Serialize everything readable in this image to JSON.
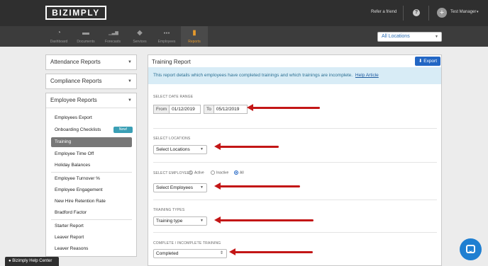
{
  "colors": {
    "topbar": "#2f2f2f",
    "nav": "#3c3c3c",
    "accent": "#e69a2c",
    "primary": "#2266c4",
    "arrow": "#c31616",
    "info_bg": "#d8ecf6",
    "badge": "#3a9fb5"
  },
  "header": {
    "logo": "BIZIMPLY",
    "refer_label": "Refer a friend",
    "help_icon": "question-circle-icon",
    "help_glyph": "?",
    "user_name": "Test Manager",
    "user_caret": "▾",
    "avatar_glyph": "+"
  },
  "nav": {
    "items": [
      {
        "label": "Dashboard",
        "icon": "dashboard-icon",
        "glyph": "◔"
      },
      {
        "label": "Documents",
        "icon": "folder-icon",
        "glyph": "▬"
      },
      {
        "label": "Forecasts",
        "icon": "bar-chart-icon",
        "glyph": "▁▃▆"
      },
      {
        "label": "Services",
        "icon": "tag-icon",
        "glyph": "◆"
      },
      {
        "label": "Employees",
        "icon": "people-icon",
        "glyph": "●●●"
      },
      {
        "label": "Reports",
        "icon": "report-icon",
        "glyph": "▮"
      }
    ],
    "active": "Reports",
    "location_select": "All Locations"
  },
  "sidebar": {
    "attendance": "Attendance Reports",
    "compliance": "Compliance Reports",
    "employee": "Employee Reports",
    "items": [
      "Employees Export",
      "Onboarding Checklists",
      "Training",
      "Employee Time Off",
      "Holiday Balances",
      "Employee Turnover %",
      "Employee Engagement",
      "New Hire Retention Rate",
      "Bradford Factor",
      "Starter Report",
      "Leaver Report",
      "Leaver Reasons"
    ],
    "new_badge": "New!",
    "active_item": "Training"
  },
  "main": {
    "title": "Training Report",
    "export_label": "Export",
    "info_text": "This report details which employees have completed trainings and which trainings are incomplete.",
    "info_link": "Help Article",
    "date_range_label": "SELECT DATE RANGE",
    "from_label": "From",
    "from_value": "01/12/2019",
    "to_label": "To",
    "to_value": "05/12/2019",
    "locations_label": "SELECT LOCATIONS",
    "locations_select": "Select Locations",
    "employees_label": "SELECT EMPLOYEES",
    "radio_active": "Active",
    "radio_inactive": "Inactive",
    "radio_all": "All",
    "radio_selected": "All",
    "employees_select": "Select Employees",
    "training_types_label": "TRAINING TYPES",
    "training_select": "Training type",
    "complete_label": "COMPLETE / INCOMPLETE TRAINING",
    "complete_select": "Completed"
  },
  "footer": {
    "help_center": "Bizimply Help Center",
    "chat_icon": "chat-bubble-icon"
  }
}
